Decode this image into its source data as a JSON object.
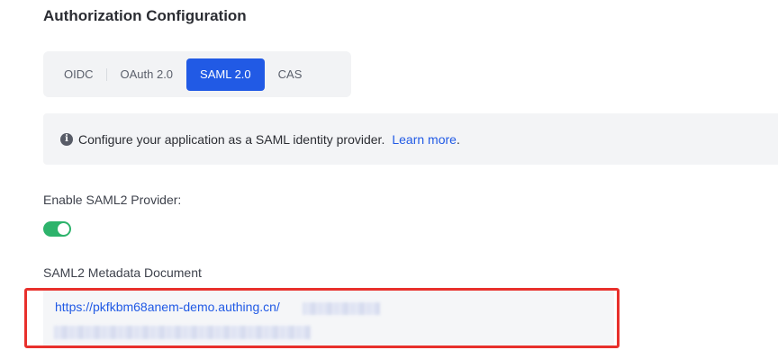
{
  "page": {
    "title": "Authorization Configuration"
  },
  "tabs": [
    {
      "label": "OIDC",
      "active": false
    },
    {
      "label": "OAuth 2.0",
      "active": false
    },
    {
      "label": "SAML 2.0",
      "active": true
    },
    {
      "label": "CAS",
      "active": false
    }
  ],
  "info": {
    "icon": "info-icon",
    "text": "Configure your application as a SAML identity provider.",
    "link": "Learn more",
    "link_suffix": "."
  },
  "saml_provider": {
    "label": "Enable SAML2 Provider:",
    "enabled": true
  },
  "metadata": {
    "label": "SAML2 Metadata Document",
    "url_visible": "https://pkfkbm68anem-demo.authing.cn/"
  },
  "colors": {
    "accent": "#215ae5",
    "toggle_on": "#2db36b",
    "highlight": "#e8302c"
  }
}
